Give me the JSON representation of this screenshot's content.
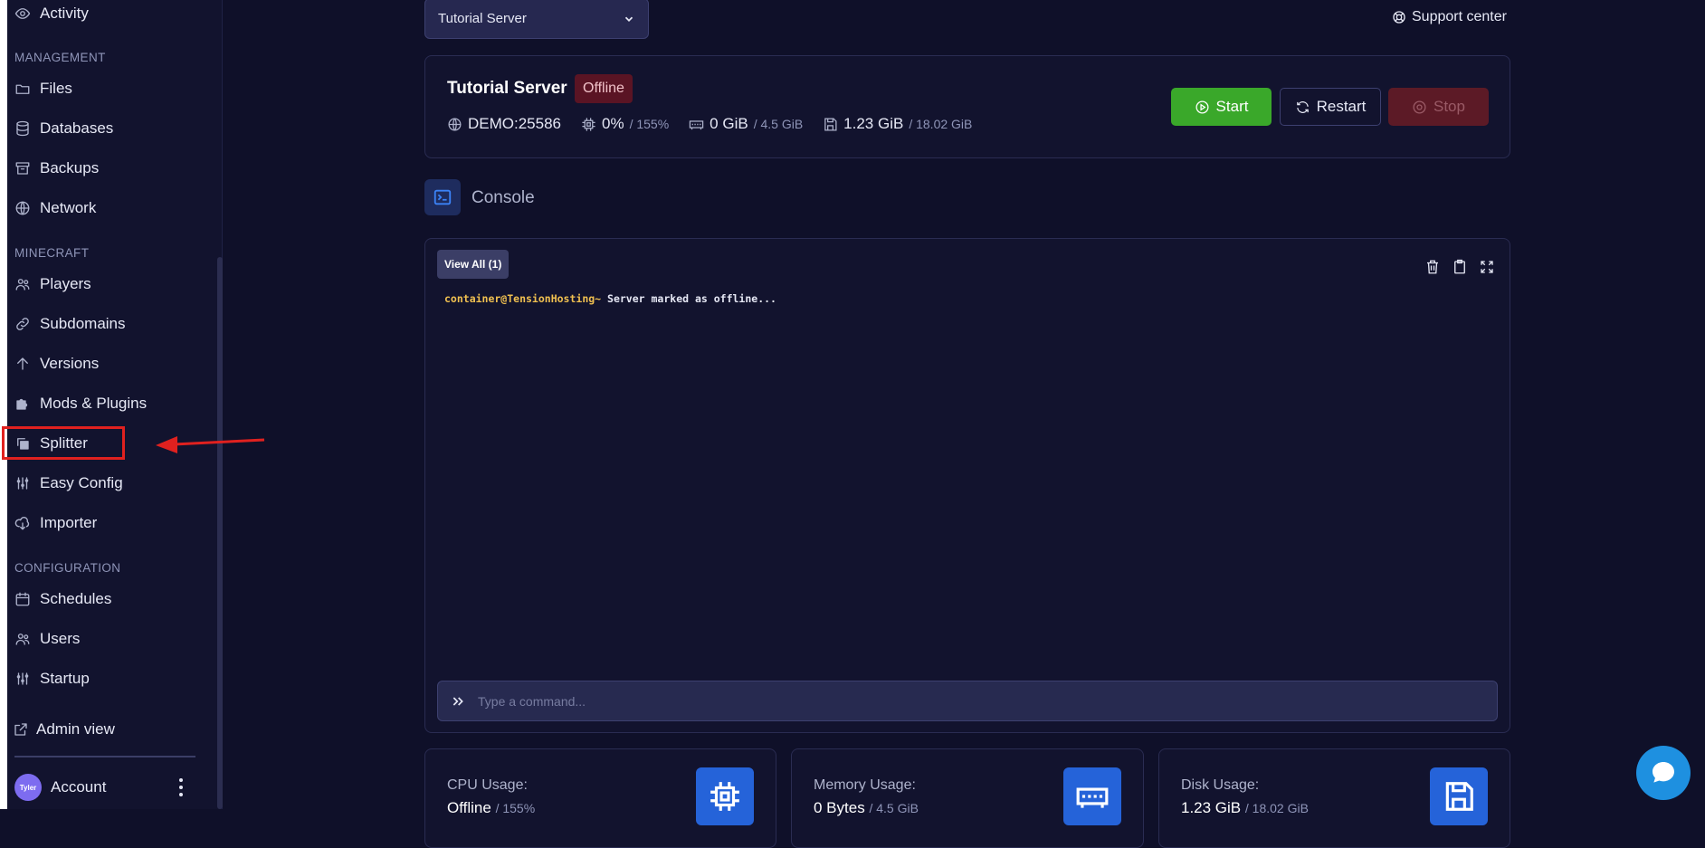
{
  "sidebar": {
    "top_item": {
      "label": "Activity",
      "icon": "eye-icon"
    },
    "sections": [
      {
        "title": "MANAGEMENT",
        "items": [
          "Files",
          "Databases",
          "Backups",
          "Network"
        ]
      },
      {
        "title": "MINECRAFT",
        "items": [
          "Players",
          "Subdomains",
          "Versions",
          "Mods & Plugins",
          "Splitter",
          "Easy Config",
          "Importer"
        ]
      },
      {
        "title": "CONFIGURATION",
        "items": [
          "Schedules",
          "Users",
          "Startup"
        ]
      }
    ],
    "admin_view": "Admin view",
    "account": {
      "label": "Account",
      "avatar_text": "Tyler"
    }
  },
  "header": {
    "server_select": "Tutorial Server",
    "support": "Support center"
  },
  "server": {
    "name": "Tutorial Server",
    "status": "Offline",
    "address": "DEMO:25586",
    "cpu": "0%",
    "cpu_limit": "/ 155%",
    "memory": "0 GiB",
    "memory_limit": "/ 4.5 GiB",
    "disk": "1.23 GiB",
    "disk_limit": "/ 18.02 GiB",
    "buttons": {
      "start": "Start",
      "restart": "Restart",
      "stop": "Stop"
    }
  },
  "console": {
    "title": "Console",
    "view_all": "View All (1)",
    "prompt": "container@TensionHosting~",
    "message": "Server marked as offline...",
    "command_placeholder": "Type a command..."
  },
  "usage": [
    {
      "label": "CPU Usage:",
      "value": "Offline",
      "limit": "/ 155%"
    },
    {
      "label": "Memory Usage:",
      "value": "0 Bytes",
      "limit": "/ 4.5 GiB"
    },
    {
      "label": "Disk Usage:",
      "value": "1.23 GiB",
      "limit": "/ 18.02 GiB"
    }
  ],
  "colors": {
    "start": "#3aa82a",
    "stop": "#5c1a26",
    "accent": "#2563d9",
    "highlight": "#e0211f"
  }
}
